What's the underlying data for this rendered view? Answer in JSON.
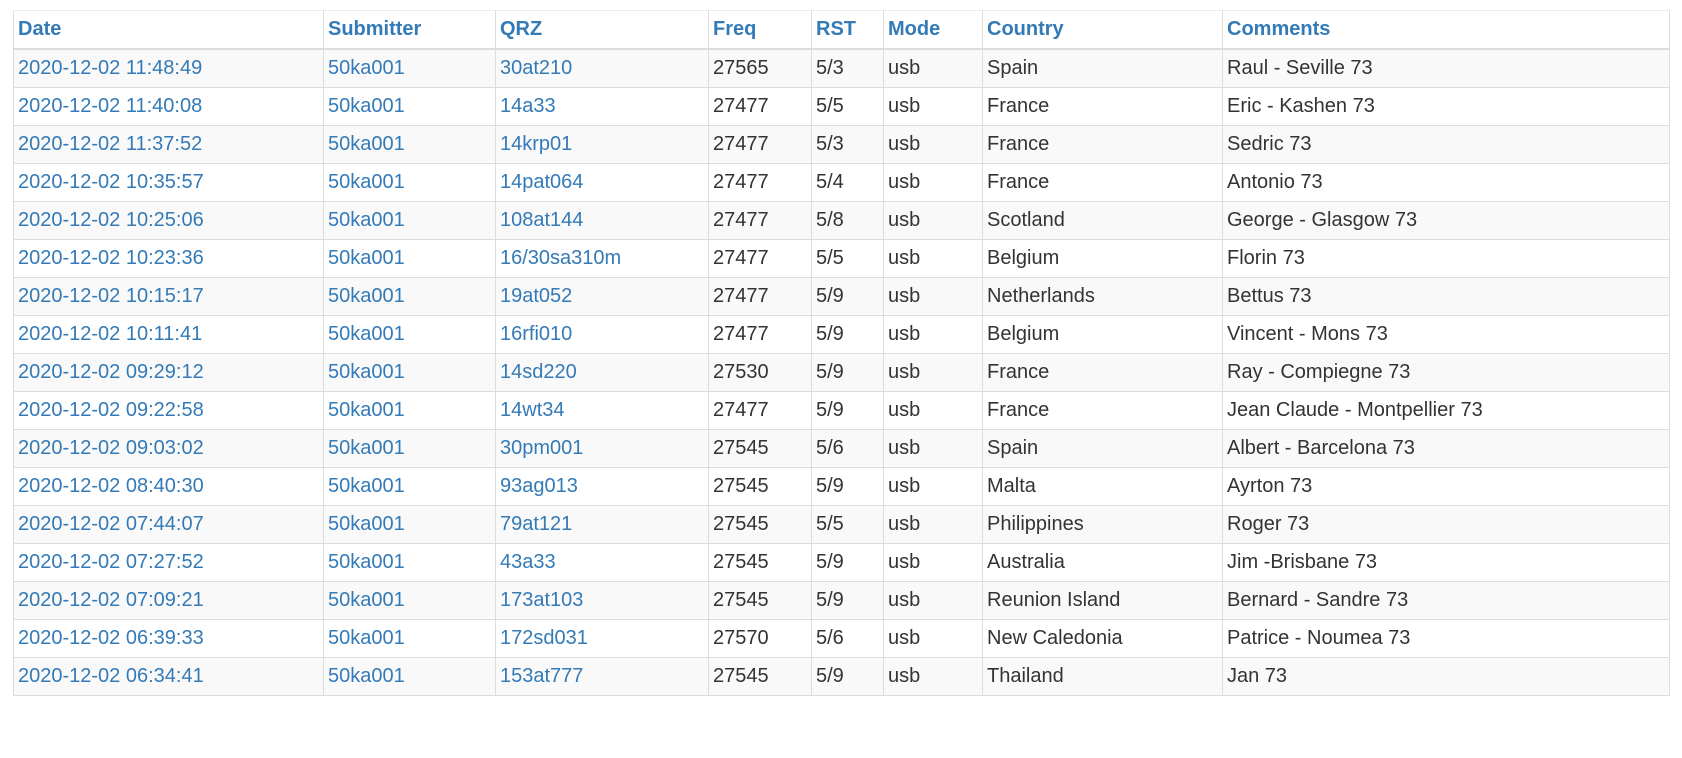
{
  "table": {
    "headers": {
      "date": "Date",
      "submitter": "Submitter",
      "qrz": "QRZ",
      "freq": "Freq",
      "rst": "RST",
      "mode": "Mode",
      "country": "Country",
      "comments": "Comments"
    },
    "rows": [
      {
        "date": "2020-12-02 11:48:49",
        "submitter": "50ka001",
        "qrz": "30at210",
        "freq": "27565",
        "rst": "5/3",
        "mode": "usb",
        "country": "Spain",
        "comments": "Raul - Seville 73"
      },
      {
        "date": "2020-12-02 11:40:08",
        "submitter": "50ka001",
        "qrz": "14a33",
        "freq": "27477",
        "rst": "5/5",
        "mode": "usb",
        "country": "France",
        "comments": "Eric - Kashen 73"
      },
      {
        "date": "2020-12-02 11:37:52",
        "submitter": "50ka001",
        "qrz": "14krp01",
        "freq": "27477",
        "rst": "5/3",
        "mode": "usb",
        "country": "France",
        "comments": "Sedric 73"
      },
      {
        "date": "2020-12-02 10:35:57",
        "submitter": "50ka001",
        "qrz": "14pat064",
        "freq": "27477",
        "rst": "5/4",
        "mode": "usb",
        "country": "France",
        "comments": "Antonio 73"
      },
      {
        "date": "2020-12-02 10:25:06",
        "submitter": "50ka001",
        "qrz": "108at144",
        "freq": "27477",
        "rst": "5/8",
        "mode": "usb",
        "country": "Scotland",
        "comments": "George - Glasgow 73"
      },
      {
        "date": "2020-12-02 10:23:36",
        "submitter": "50ka001",
        "qrz": "16/30sa310m",
        "freq": "27477",
        "rst": "5/5",
        "mode": "usb",
        "country": "Belgium",
        "comments": "Florin 73"
      },
      {
        "date": "2020-12-02 10:15:17",
        "submitter": "50ka001",
        "qrz": "19at052",
        "freq": "27477",
        "rst": "5/9",
        "mode": "usb",
        "country": "Netherlands",
        "comments": "Bettus 73"
      },
      {
        "date": "2020-12-02 10:11:41",
        "submitter": "50ka001",
        "qrz": "16rfi010",
        "freq": "27477",
        "rst": "5/9",
        "mode": "usb",
        "country": "Belgium",
        "comments": "Vincent - Mons 73"
      },
      {
        "date": "2020-12-02 09:29:12",
        "submitter": "50ka001",
        "qrz": "14sd220",
        "freq": "27530",
        "rst": "5/9",
        "mode": "usb",
        "country": "France",
        "comments": "Ray - Compiegne 73"
      },
      {
        "date": "2020-12-02 09:22:58",
        "submitter": "50ka001",
        "qrz": "14wt34",
        "freq": "27477",
        "rst": "5/9",
        "mode": "usb",
        "country": "France",
        "comments": "Jean Claude - Montpellier 73"
      },
      {
        "date": "2020-12-02 09:03:02",
        "submitter": "50ka001",
        "qrz": "30pm001",
        "freq": "27545",
        "rst": "5/6",
        "mode": "usb",
        "country": "Spain",
        "comments": "Albert - Barcelona 73"
      },
      {
        "date": "2020-12-02 08:40:30",
        "submitter": "50ka001",
        "qrz": "93ag013",
        "freq": "27545",
        "rst": "5/9",
        "mode": "usb",
        "country": "Malta",
        "comments": "Ayrton 73"
      },
      {
        "date": "2020-12-02 07:44:07",
        "submitter": "50ka001",
        "qrz": "79at121",
        "freq": "27545",
        "rst": "5/5",
        "mode": "usb",
        "country": "Philippines",
        "comments": "Roger 73"
      },
      {
        "date": "2020-12-02 07:27:52",
        "submitter": "50ka001",
        "qrz": "43a33",
        "freq": "27545",
        "rst": "5/9",
        "mode": "usb",
        "country": "Australia",
        "comments": "Jim -Brisbane 73"
      },
      {
        "date": "2020-12-02 07:09:21",
        "submitter": "50ka001",
        "qrz": "173at103",
        "freq": "27545",
        "rst": "5/9",
        "mode": "usb",
        "country": "Reunion Island",
        "comments": "Bernard - Sandre 73"
      },
      {
        "date": "2020-12-02 06:39:33",
        "submitter": "50ka001",
        "qrz": "172sd031",
        "freq": "27570",
        "rst": "5/6",
        "mode": "usb",
        "country": "New Caledonia",
        "comments": "Patrice - Noumea 73"
      },
      {
        "date": "2020-12-02 06:34:41",
        "submitter": "50ka001",
        "qrz": "153at777",
        "freq": "27545",
        "rst": "5/9",
        "mode": "usb",
        "country": "Thailand",
        "comments": "Jan 73"
      }
    ]
  },
  "colors": {
    "link": "#337ab7",
    "text": "#333333",
    "border": "#dddddd",
    "stripe": "#f9f9f9"
  }
}
